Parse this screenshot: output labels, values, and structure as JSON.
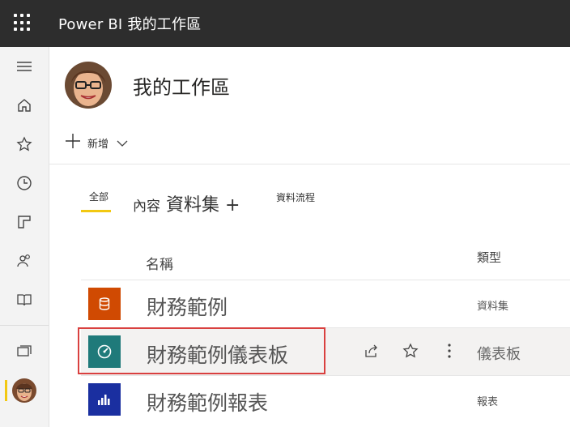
{
  "topbar": {
    "app_name": "Power BI",
    "workspace": "我的工作區"
  },
  "workspace": {
    "title": "我的工作區"
  },
  "toolbar": {
    "new_label": "新增"
  },
  "tabs": {
    "all": "全部",
    "content": "內容",
    "datasets": "資料集",
    "plus": "+",
    "dataflows": "資料流程"
  },
  "columns": {
    "name": "名稱",
    "type": "類型"
  },
  "rows": [
    {
      "name": "財務範例",
      "type": "資料集",
      "icon": "dataset-icon",
      "color": "#d04a02"
    },
    {
      "name": "財務範例儀表板",
      "type": "儀表板",
      "icon": "dashboard-icon",
      "color": "#1f7a7a"
    },
    {
      "name": "財務範例報表",
      "type": "報表",
      "icon": "report-icon",
      "color": "#1a2fa0"
    }
  ],
  "colors": {
    "accent": "#f2c811",
    "highlight": "#d9403f",
    "topbar": "#2d2d2d"
  }
}
